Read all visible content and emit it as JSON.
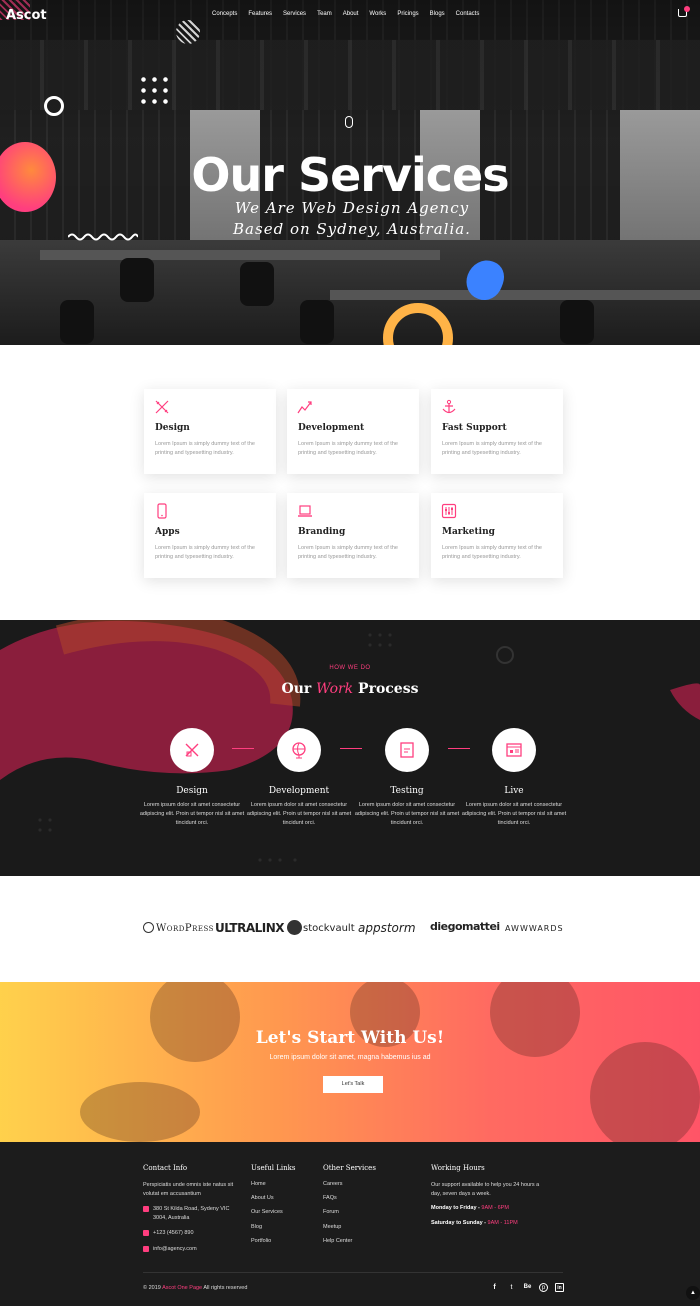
{
  "header": {
    "logo": "Ascot",
    "nav": [
      "Concepts",
      "Features",
      "Services",
      "Team",
      "About",
      "Works",
      "Pricings",
      "Blogs",
      "Contacts"
    ]
  },
  "hero": {
    "title": "Our Services",
    "subtitle": "We Are Web Design Agency Based on Sydney, Australia."
  },
  "services": [
    {
      "title": "Design",
      "desc": "Lorem Ipsum is simply dummy text of the printing and typesetting industry.",
      "icon": "tools-icon"
    },
    {
      "title": "Development",
      "desc": "Lorem Ipsum is simply dummy text of the printing and typesetting industry.",
      "icon": "chart-line-icon"
    },
    {
      "title": "Fast Support",
      "desc": "Lorem Ipsum is simply dummy text of the printing and typesetting industry.",
      "icon": "anchor-icon"
    },
    {
      "title": "Apps",
      "desc": "Lorem Ipsum is simply dummy text of the printing and typesetting industry.",
      "icon": "phone-icon"
    },
    {
      "title": "Branding",
      "desc": "Lorem Ipsum is simply dummy text of the printing and typesetting industry.",
      "icon": "laptop-icon"
    },
    {
      "title": "Marketing",
      "desc": "Lorem Ipsum is simply dummy text of the printing and typesetting industry.",
      "icon": "sliders-icon"
    }
  ],
  "process": {
    "eyebrow": "HOW WE DO",
    "title_pre": "Our ",
    "title_em": "Work",
    "title_post": " Process",
    "steps": [
      {
        "title": "Design",
        "desc": "Lorem ipsum dolor sit amet consectetur adipiscing elit. Proin ut tempor nisl sit amet tincidunt orci.",
        "icon": "pen-ruler-icon"
      },
      {
        "title": "Development",
        "desc": "Lorem ipsum dolor sit amet consectetur adipiscing elit. Proin ut tempor nisl sit amet tincidunt orci.",
        "icon": "globe-icon"
      },
      {
        "title": "Testing",
        "desc": "Lorem ipsum dolor sit amet consectetur adipiscing elit. Proin ut tempor nisl sit amet tincidunt orci.",
        "icon": "document-icon"
      },
      {
        "title": "Live",
        "desc": "Lorem ipsum dolor sit amet consectetur adipiscing elit. Proin ut tempor nisl sit amet tincidunt orci.",
        "icon": "browser-icon"
      }
    ]
  },
  "brands": [
    "WordPress",
    "ULTRALINX",
    "stockvault",
    "appstorm",
    "diegomattei",
    "AWWWARDS"
  ],
  "cta": {
    "title": "Let's Start With Us!",
    "subtitle": "Lorem ipsum dolor sit amet, magna habemus ius ad",
    "button": "Let's Talk"
  },
  "footer": {
    "contact": {
      "heading": "Contact Info",
      "text": "Perspiciatis unde omnis iste natus sit volutat em accusantium",
      "address": "380 St Kilda Road, Sydeny VIC 3004, Australia",
      "phone": "+123 (4567) 890",
      "email": "info@agency.com"
    },
    "useful": {
      "heading": "Useful Links",
      "links": [
        "Home",
        "About Us",
        "Our Services",
        "Blog",
        "Portfolio"
      ]
    },
    "other": {
      "heading": "Other Services",
      "links": [
        "Careers",
        "FAQs",
        "Forum",
        "Meetup",
        "Help Center"
      ]
    },
    "hours": {
      "heading": "Working Hours",
      "text": "Our support available to help you 24 hours a day, seven days a week.",
      "row1_label": "Monday to Friday -",
      "row1_time": "9AM - 6PM",
      "row2_label": "Saturday to Sunday -",
      "row2_time": "9AM - 11PM"
    },
    "copyright_pre": "© 2019",
    "copyright_link": "Ascot One Page",
    "copyright_post": "All rights reserved",
    "social": [
      "f",
      "t",
      "Be",
      "p",
      "in"
    ],
    "social_icons": [
      "facebook-icon",
      "twitter-icon",
      "behance-icon",
      "pinterest-icon",
      "linkedin-icon"
    ]
  },
  "colors": {
    "accent": "#ff3e7f",
    "dark": "#1a1a1a",
    "footer": "#1c1c1c"
  }
}
